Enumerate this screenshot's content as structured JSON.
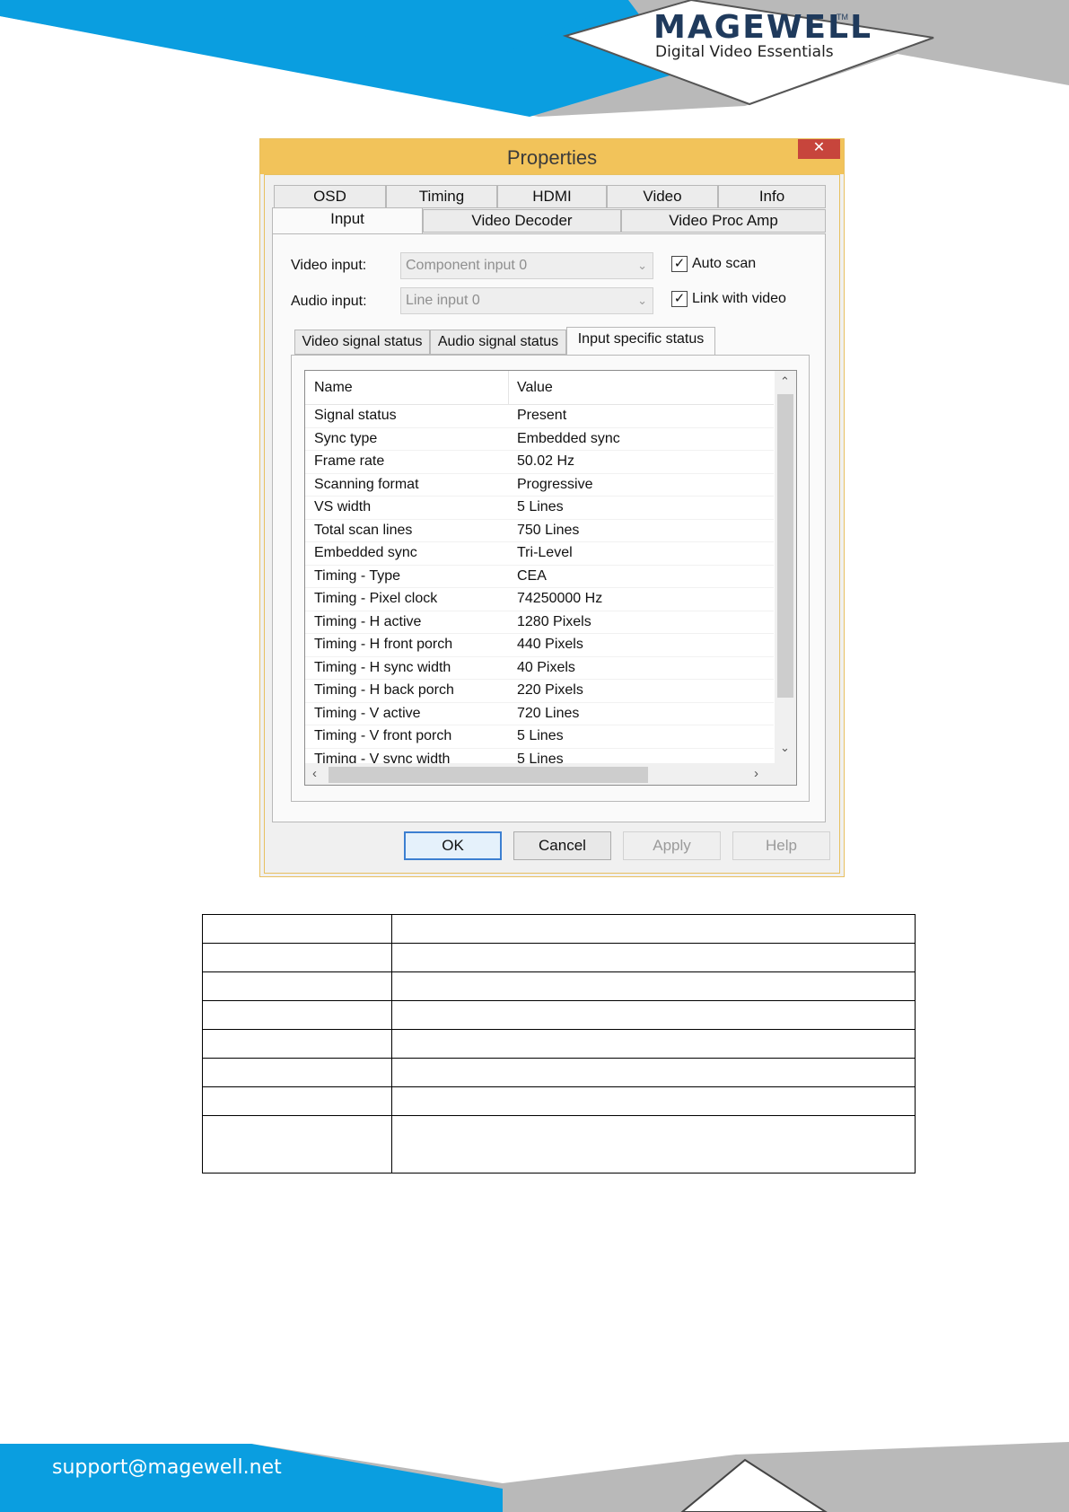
{
  "page_header": {
    "brand": "MAGEWELL",
    "trademark": "TM",
    "tagline": "Digital Video Essentials",
    "colors": {
      "blue": "#0a9ee0",
      "grey": "#b8b8b8",
      "navy": "#1f3a5c"
    }
  },
  "dialog": {
    "title": "Properties",
    "close_icon": "close-icon",
    "tabs_row1": [
      "OSD",
      "Timing",
      "HDMI",
      "Video",
      "Info"
    ],
    "tabs_row2": [
      "Input",
      "Video Decoder",
      "Video Proc Amp"
    ],
    "active_tab": "Input",
    "video_input": {
      "label": "Video input:",
      "value": "Component input 0"
    },
    "audio_input": {
      "label": "Audio input:",
      "value": "Line input 0"
    },
    "auto_scan": {
      "label": "Auto scan",
      "checked": true
    },
    "link_with_video": {
      "label": "Link with video",
      "checked": true
    },
    "subtabs": [
      "Video signal status",
      "Audio signal status",
      "Input specific status"
    ],
    "active_subtab": "Input specific status",
    "list": {
      "columns": [
        "Name",
        "Value"
      ],
      "rows": [
        [
          "Signal status",
          "Present"
        ],
        [
          "Sync type",
          "Embedded sync"
        ],
        [
          "Frame rate",
          "50.02 Hz"
        ],
        [
          "Scanning format",
          "Progressive"
        ],
        [
          "VS width",
          "5 Lines"
        ],
        [
          "Total scan lines",
          "750 Lines"
        ],
        [
          "Embedded sync",
          "Tri-Level"
        ],
        [
          "Timing - Type",
          "CEA"
        ],
        [
          "Timing - Pixel clock",
          "74250000 Hz"
        ],
        [
          "Timing - H active",
          "1280 Pixels"
        ],
        [
          "Timing - H front porch",
          "440 Pixels"
        ],
        [
          "Timing - H sync width",
          "40 Pixels"
        ],
        [
          "Timing - H back porch",
          "220 Pixels"
        ],
        [
          "Timing - V active",
          "720 Lines"
        ],
        [
          "Timing - V front porch",
          "5 Lines"
        ],
        [
          "Timing - V sync width",
          "5 Lines"
        ]
      ]
    },
    "buttons": {
      "ok": "OK",
      "cancel": "Cancel",
      "apply": "Apply",
      "help": "Help"
    }
  },
  "table": {
    "rows": 8
  },
  "footer": {
    "email": "support@magewell.net"
  }
}
